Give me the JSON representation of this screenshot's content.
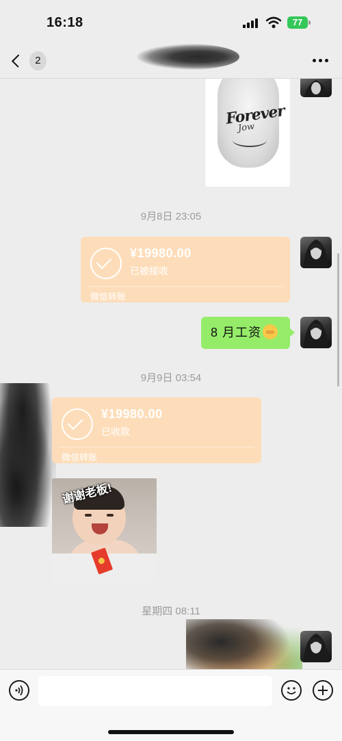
{
  "status_bar": {
    "time": "16:18",
    "battery": "77"
  },
  "nav": {
    "unread_count": "2"
  },
  "messages": {
    "time_1": "9月8日 23:05",
    "transfer_1": {
      "amount": "¥19980.00",
      "status": "已被接收",
      "footer": "微信转账"
    },
    "text_1": "8 月工资",
    "time_2": "9月9日 03:54",
    "transfer_2": {
      "amount": "¥19980.00",
      "status": "已收款",
      "footer": "微信转账"
    },
    "sticker_caption": "谢谢老板!",
    "time_3": "星期四 08:11",
    "image_1": {
      "tattoo_text_1": "Forever",
      "tattoo_text_2": "Jow"
    }
  },
  "colors": {
    "background": "#ededed",
    "transfer_card": "#fdddb9",
    "bubble_self": "#95ec69",
    "battery": "#34c759"
  },
  "icons": [
    "back-chevron-icon",
    "more-icon",
    "voice-icon",
    "emoji-icon",
    "plus-icon",
    "signal-icon",
    "wifi-icon",
    "battery-icon"
  ]
}
